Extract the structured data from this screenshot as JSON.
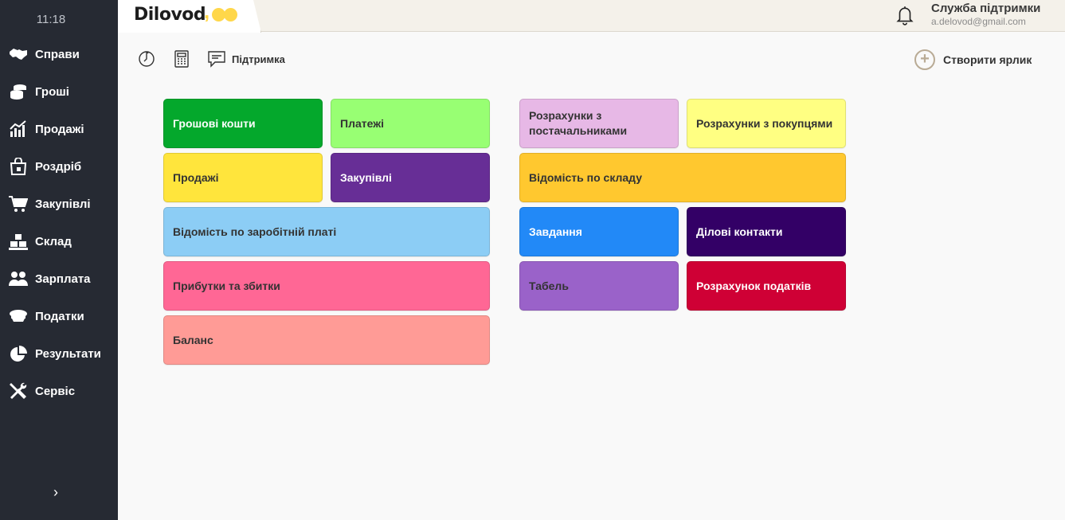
{
  "sidebar": {
    "time": "11:18",
    "items": [
      {
        "label": "Справи",
        "icon": "handshake-icon"
      },
      {
        "label": "Гроші",
        "icon": "coins-icon"
      },
      {
        "label": "Продажі",
        "icon": "chart-icon"
      },
      {
        "label": "Роздріб",
        "icon": "shopping-bag-icon"
      },
      {
        "label": "Закупівлі",
        "icon": "cart-icon"
      },
      {
        "label": "Склад",
        "icon": "boxes-icon"
      },
      {
        "label": "Зарплата",
        "icon": "people-icon"
      },
      {
        "label": "Податки",
        "icon": "officer-cap-icon"
      },
      {
        "label": "Результати",
        "icon": "pie-chart-icon"
      },
      {
        "label": "Сервіс",
        "icon": "tools-icon"
      }
    ],
    "expand_glyph": "›"
  },
  "header": {
    "logo_text": "Dilovod",
    "support_name": "Служба підтримки",
    "support_email": "a.delovod@gmail.com"
  },
  "toolbar": {
    "support_label": "Підтримка",
    "create_shortcut_label": "Створити ярлик",
    "plus_glyph": "+"
  },
  "tiles": [
    {
      "id": "cash",
      "label": "Грошові кошти",
      "color": "#04a82c",
      "text": "dark"
    },
    {
      "id": "payments",
      "label": "Платежі",
      "color": "#98ff73",
      "text": "light"
    },
    {
      "id": "sales",
      "label": "Продажі",
      "color": "#ffe53c",
      "text": "light"
    },
    {
      "id": "purchases",
      "label": "Закупівлі",
      "color": "#672e96",
      "text": "dark"
    },
    {
      "id": "payroll",
      "label": "Відомість по заробітній платі",
      "color": "#8ccdf5",
      "text": "light"
    },
    {
      "id": "profit-loss",
      "label": "Прибутки та збитки",
      "color": "#ff6795",
      "text": "light"
    },
    {
      "id": "balance",
      "label": "Баланс",
      "color": "#ff9b96",
      "text": "light"
    },
    {
      "id": "suppliers",
      "label": "Розрахунки з постачальниками",
      "color": "#e7b8e6",
      "text": "light"
    },
    {
      "id": "customers",
      "label": "Розрахунки з покупцями",
      "color": "#ffff82",
      "text": "light"
    },
    {
      "id": "warehouse",
      "label": "Відомість по складу",
      "color": "#ffc82f",
      "text": "light"
    },
    {
      "id": "tasks",
      "label": "Завдання",
      "color": "#2289f7",
      "text": "dark"
    },
    {
      "id": "contacts",
      "label": "Ділові контакти",
      "color": "#330066",
      "text": "dark"
    },
    {
      "id": "timesheet",
      "label": "Табель",
      "color": "#9a62c9",
      "text": "light"
    },
    {
      "id": "taxes",
      "label": "Розрахунок податків",
      "color": "#cf0035",
      "text": "dark"
    }
  ]
}
